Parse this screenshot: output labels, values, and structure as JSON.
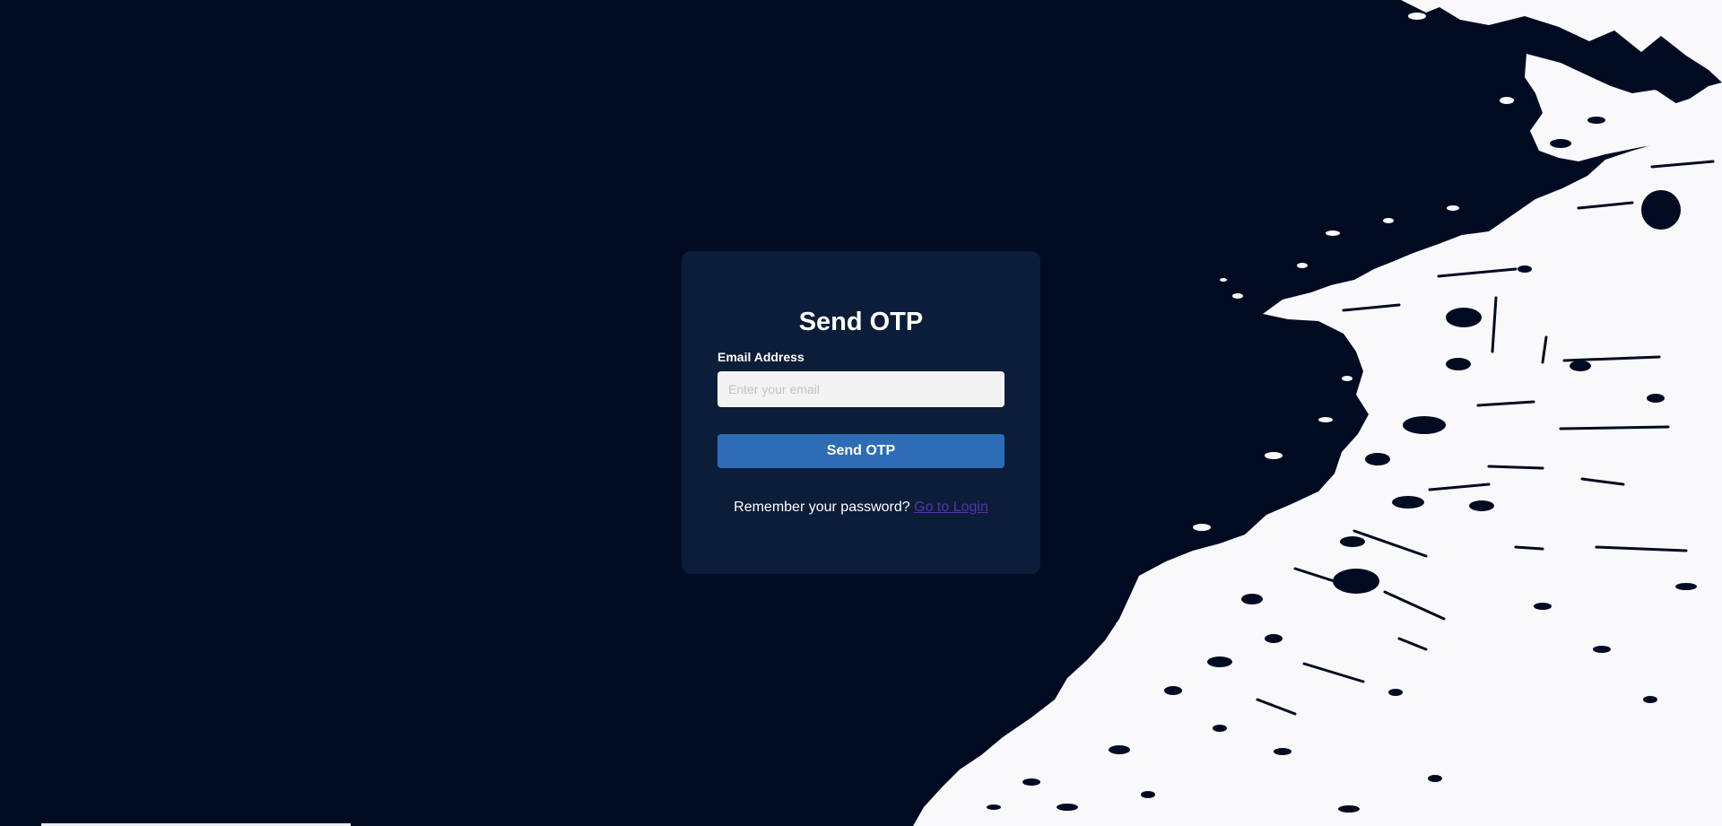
{
  "form": {
    "title": "Send OTP",
    "email_label": "Email Address",
    "email_placeholder": "Enter your email",
    "email_value": "",
    "submit_label": "Send OTP",
    "footer_text": "Remember your password?",
    "footer_link": "Go to Login"
  },
  "colors": {
    "background": "#000b22",
    "card": "#0b1d38",
    "button": "#2d6db5",
    "link": "#5b2fb0",
    "splash": "#f9f9fb"
  }
}
